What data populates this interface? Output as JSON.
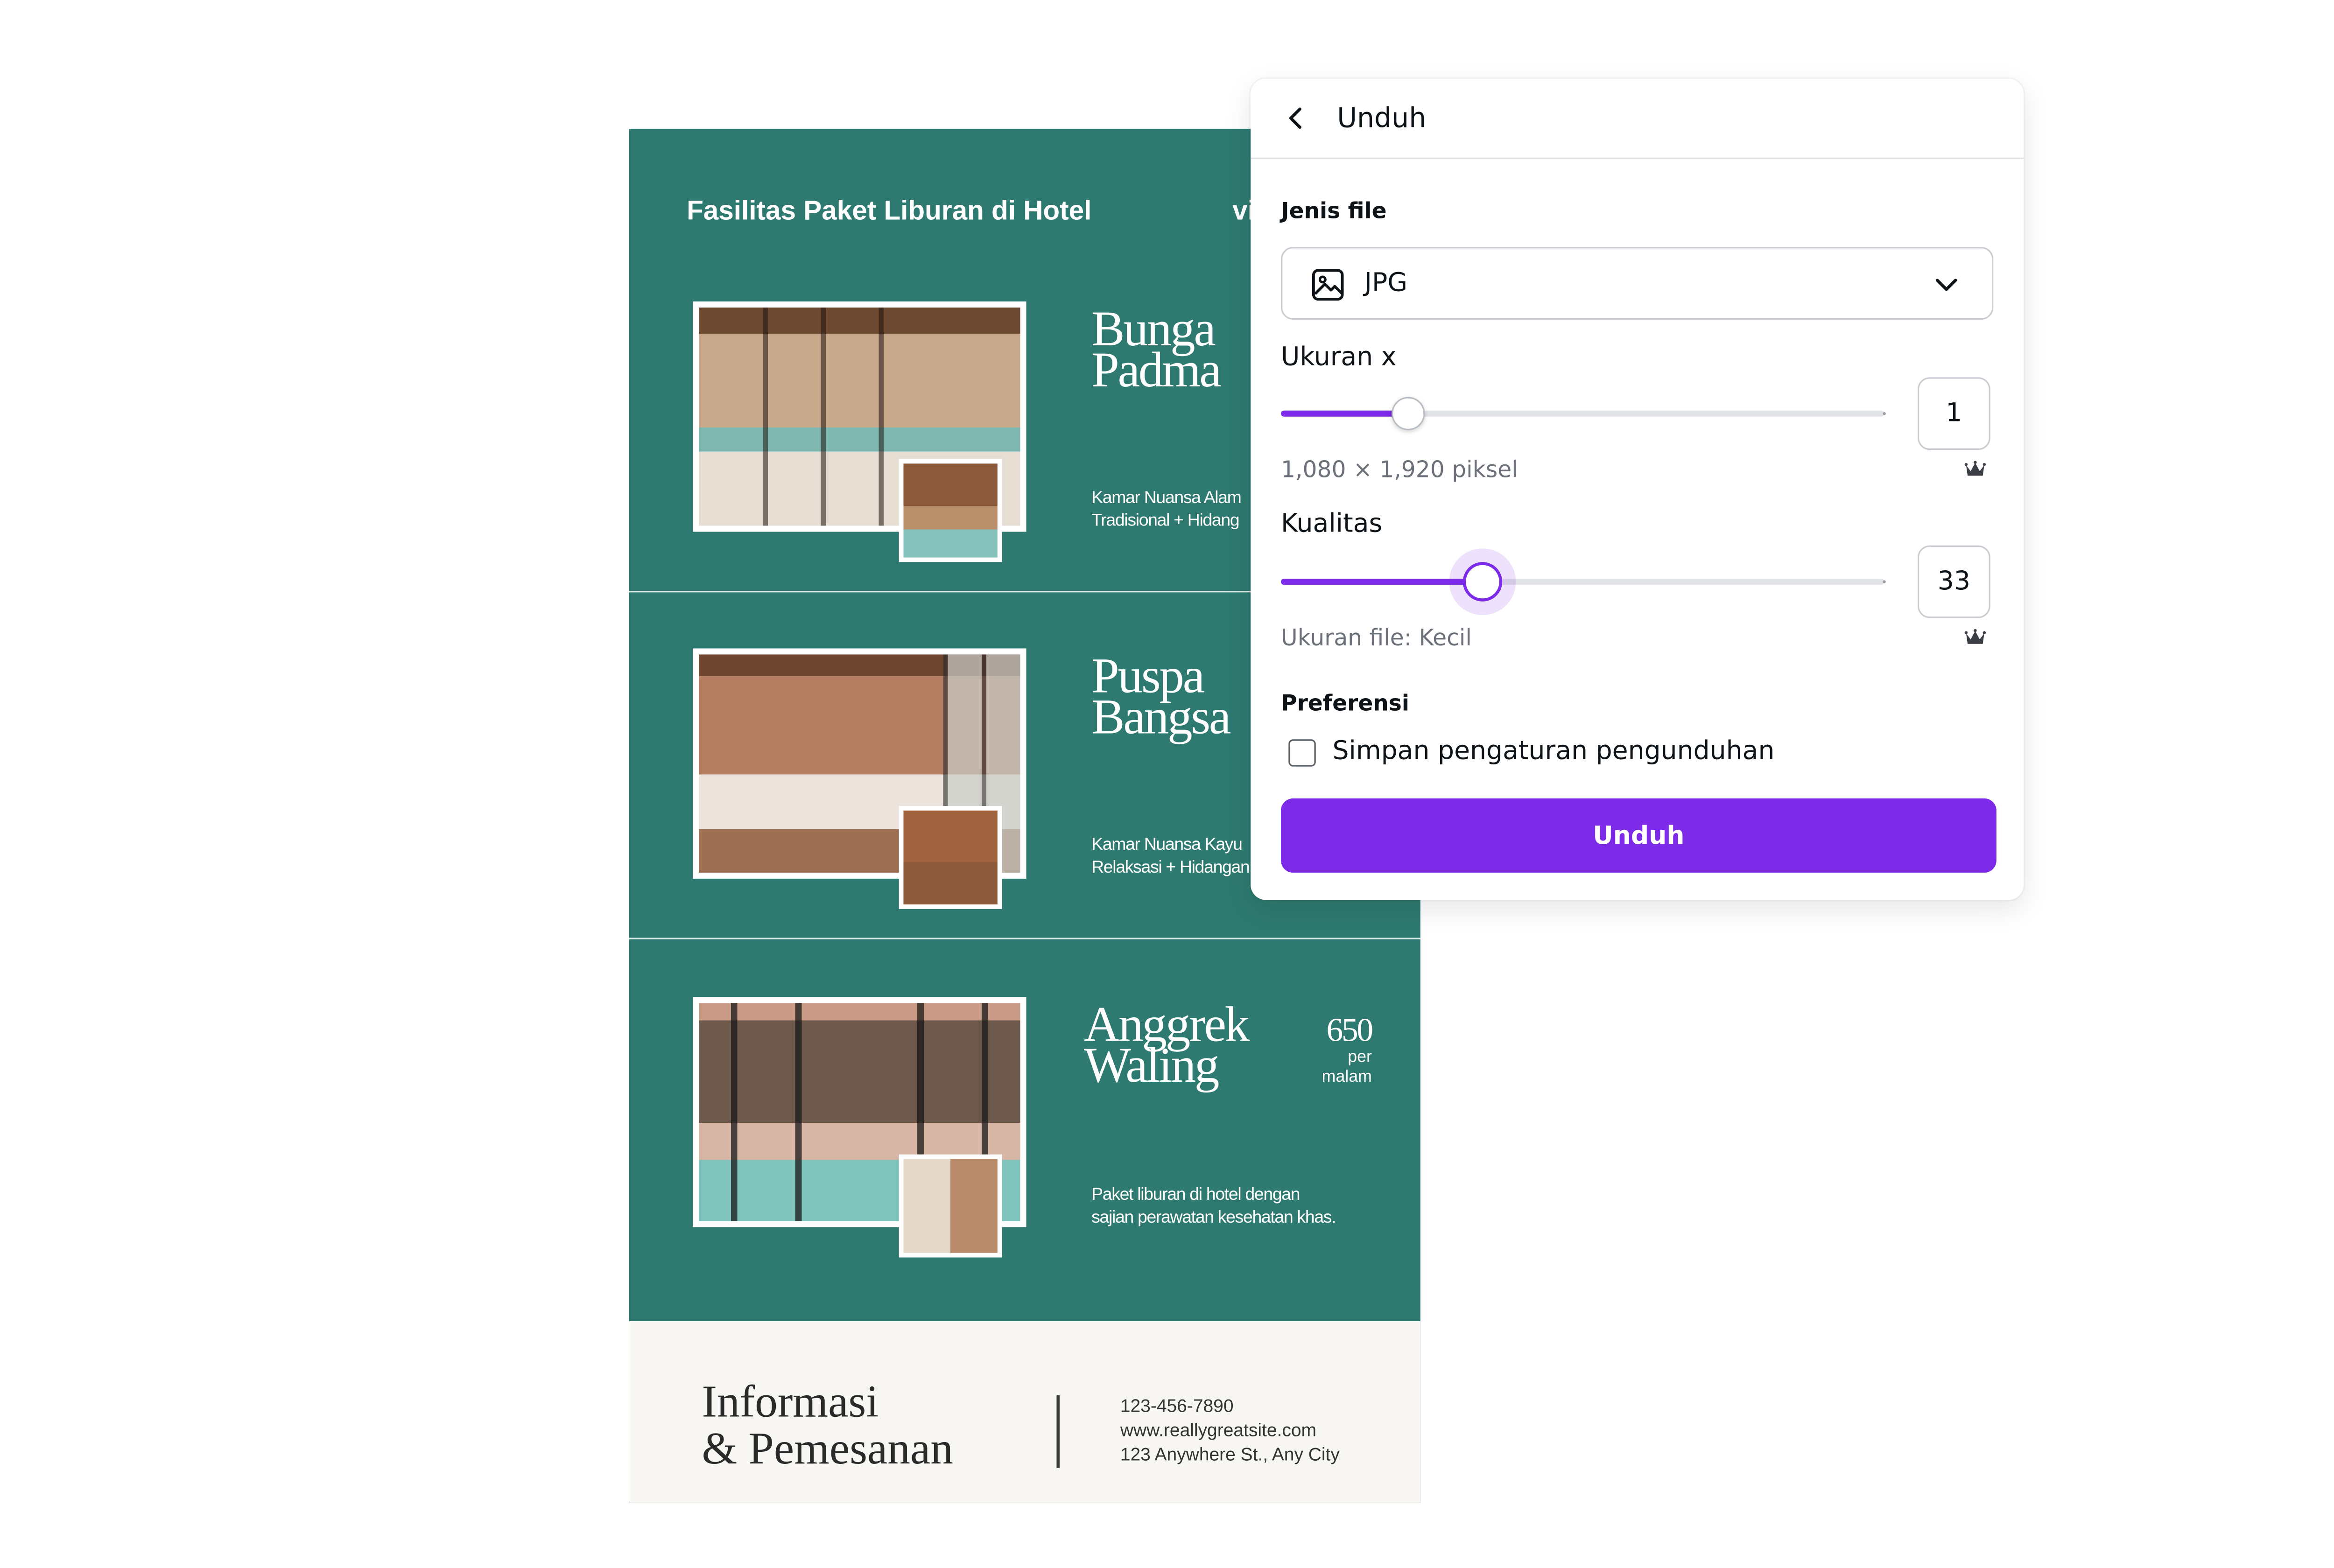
{
  "flyer": {
    "title": "Fasilitas Paket Liburan di Hotel",
    "tag_fragment": "vi",
    "rooms": [
      {
        "name_line1": "Bunga",
        "name_line2": "Padma",
        "desc_line1": "Kamar Nuansa Alam",
        "desc_line2": "Tradisional + Hidang"
      },
      {
        "name_line1": "Puspa",
        "name_line2": "Bangsa",
        "desc_line1": "Kamar Nuansa Kayu",
        "desc_line2": "Relaksasi + Hidangan"
      },
      {
        "name_line1": "Anggrek",
        "name_line2": "Waling",
        "desc_line1": "Paket liburan di hotel dengan",
        "desc_line2": "sajian perawatan kesehatan khas.",
        "price": "650",
        "price_unit_line1": "per",
        "price_unit_line2": "malam"
      }
    ],
    "footer": {
      "title_line1": "Informasi",
      "title_line2": "& Pemesanan",
      "phone": "123-456-7890",
      "website": "www.reallygreatsite.com",
      "address": "123 Anywhere St., Any City"
    }
  },
  "panel": {
    "title": "Unduh",
    "back_icon": "chevron-left-icon",
    "file_type": {
      "label": "Jenis file",
      "value": "JPG",
      "icon": "image-icon",
      "dropdown_icon": "chevron-down-icon"
    },
    "size": {
      "label": "Ukuran x",
      "value": "1",
      "slider_fraction": 0.21,
      "hint": "1,080 × 1,920 piksel",
      "premium_icon": "crown-icon"
    },
    "quality": {
      "label": "Kualitas",
      "value": "33",
      "slider_fraction": 0.335,
      "hint": "Ukuran file: Kecil",
      "premium_icon": "crown-icon"
    },
    "preferences": {
      "label": "Preferensi",
      "checkbox_label": "Simpan pengaturan pengunduhan",
      "checked": false
    },
    "download_button": "Unduh"
  },
  "colors": {
    "flyer_green": "#2e7a70",
    "flyer_footer": "#f7f6f2",
    "accent_purple": "#7d2ae8",
    "track_gray": "#e1e3e6"
  }
}
